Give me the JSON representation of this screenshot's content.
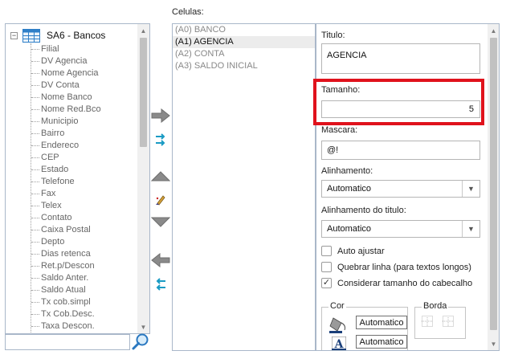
{
  "tree": {
    "root_label": "SA6 - Bancos",
    "items": [
      "Filial",
      "DV Agencia",
      "Nome Agencia",
      "DV Conta",
      "Nome Banco",
      "Nome Red.Bco",
      "Municipio",
      "Bairro",
      "Endereco",
      "CEP",
      "Estado",
      "Telefone",
      "Fax",
      "Telex",
      "Contato",
      "Caixa Postal",
      "Depto",
      "Dias retenca",
      "Ret.p/Descon",
      "Saldo Anter.",
      "Saldo Atual",
      "Tx cob.simpl",
      "Tx Cob.Desc.",
      "Taxa Descon."
    ],
    "search_value": ""
  },
  "cells": {
    "label": "Celulas:",
    "items": [
      {
        "text": "(A0) BANCO",
        "selected": false
      },
      {
        "text": "(A1) AGENCIA",
        "selected": true
      },
      {
        "text": "(A2) CONTA",
        "selected": false
      },
      {
        "text": "(A3) SALDO INICIAL",
        "selected": false
      }
    ]
  },
  "props": {
    "titulo_label": "Titulo:",
    "titulo_value": "AGENCIA",
    "tamanho_label": "Tamanho:",
    "tamanho_value": "5",
    "mascara_label": "Mascara:",
    "mascara_value": "@!",
    "alinhamento_label": "Alinhamento:",
    "alinhamento_value": "Automatico",
    "alinhamento_titulo_label": "Alinhamento do titulo:",
    "alinhamento_titulo_value": "Automatico",
    "auto_ajustar_label": "Auto ajustar",
    "auto_ajustar_checked": false,
    "quebrar_linha_label": "Quebrar linha (para textos longos)",
    "quebrar_linha_checked": false,
    "considerar_tamanho_label": "Considerar tamanho do cabecalho",
    "considerar_tamanho_checked": true,
    "cor_label": "Cor",
    "cor_fill_label": "Automatico",
    "cor_font_label": "Automatico",
    "borda_label": "Borda"
  },
  "colors": {
    "highlight": "#e0121c",
    "arrow_gray": "#8a8a8a",
    "arrow_teal": "#1a9bc4"
  }
}
